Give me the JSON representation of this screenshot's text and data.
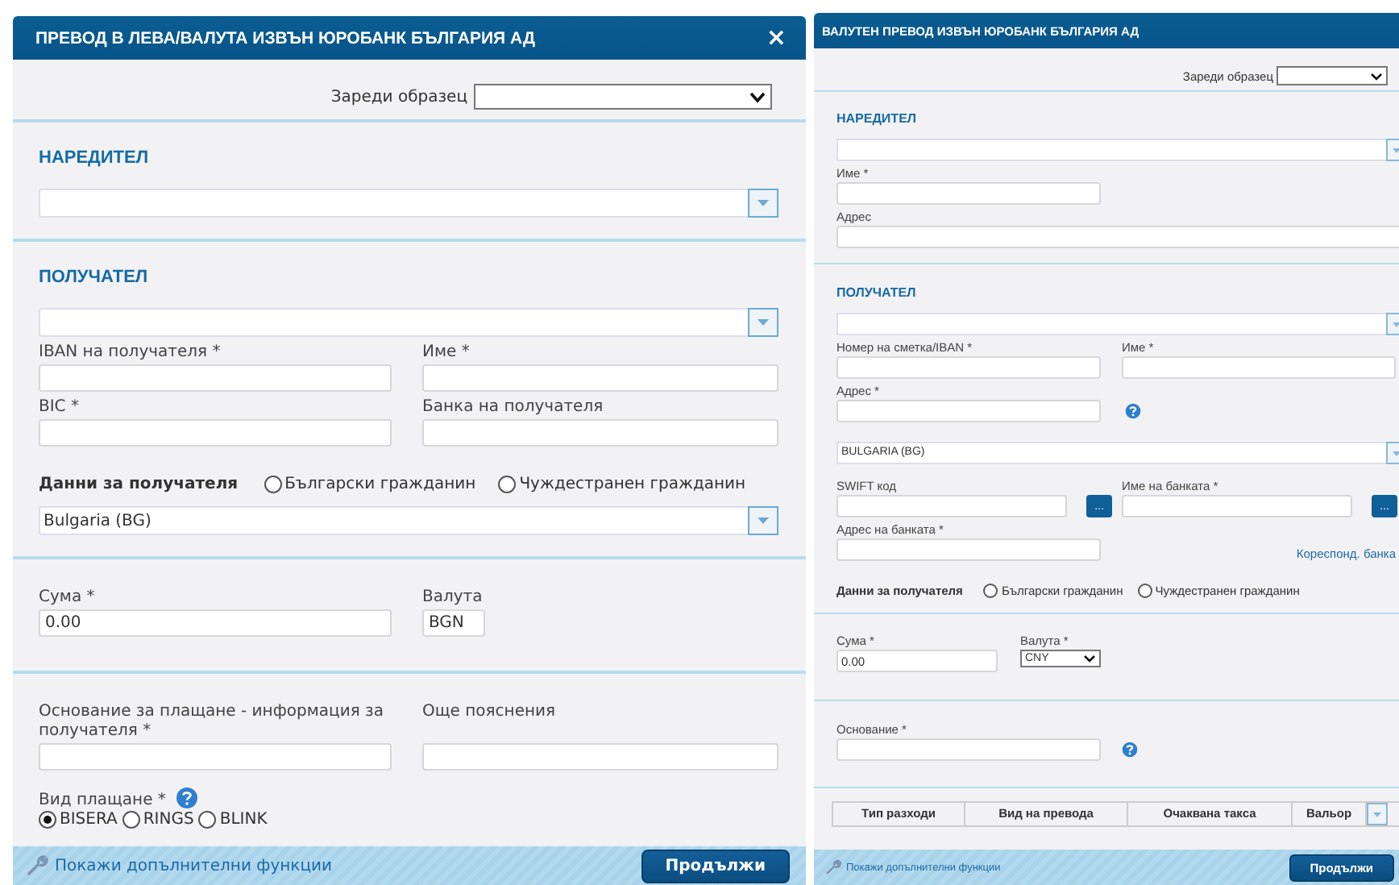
{
  "bgn_transfer": {
    "title": "ПРЕВОД В ЛЕВА/ВАЛУТА ИЗВЪН ЮРОБАНК БЪЛГАРИЯ АД",
    "close": "×",
    "template_label": "Зареди образец",
    "sender": {
      "heading": "НАРЕДИТЕЛ"
    },
    "recipient": {
      "heading": "ПОЛУЧАТЕЛ",
      "fields": [
        {
          "label": "IBAN на получателя *"
        },
        {
          "label": "Име *"
        },
        {
          "label": "BIC *"
        },
        {
          "label": "Банка на получателя"
        }
      ],
      "data_label": "Данни за получателя",
      "citizenship": [
        {
          "label": "Български гражданин",
          "selected": false
        },
        {
          "label": "Чуждестранен гражданин",
          "selected": false
        }
      ],
      "country": "Bulgaria (BG)"
    },
    "amount": {
      "label": "Сума *",
      "value": "0.00",
      "currency_label": "Валута",
      "currency": "BGN"
    },
    "reason": {
      "fields": [
        {
          "label": "Основание за плащане - информация за получателя *"
        },
        {
          "label": "Още пояснения"
        }
      ],
      "payment_type_label": "Вид плащане *",
      "payment_types": [
        {
          "label": "BISERA",
          "selected": true
        },
        {
          "label": "RINGS",
          "selected": false
        },
        {
          "label": "BLINK",
          "selected": false
        }
      ]
    },
    "footer": {
      "link": "Покажи допълнителни функции",
      "button": "Продължи"
    }
  },
  "currency_transfer": {
    "title": "ВАЛУТЕН ПРЕВОД ИЗВЪН ЮРОБАНК БЪЛГАРИЯ АД",
    "template_label": "Зареди образец",
    "sender": {
      "heading": "НАРЕДИТЕЛ",
      "name_label": "Име *",
      "address_label": "Адрес"
    },
    "recipient": {
      "heading": "ПОЛУЧАТЕЛ",
      "account_label": "Номер на сметка/IBAN *",
      "name_label": "Име *",
      "address_label": "Адрес *",
      "country": "BULGARIA (BG)",
      "swift_label": "SWIFT код",
      "bank_name_label": "Име на банката *",
      "lookup": "...",
      "bank_address_label": "Адрес на банката *",
      "correspondent_link": "Кореспонд. банка",
      "data_label": "Данни за получателя",
      "citizenship": [
        {
          "label": "Български гражданин",
          "selected": false
        },
        {
          "label": "Чуждестранен гражданин",
          "selected": false
        }
      ]
    },
    "amount": {
      "label": "Сума *",
      "value": "0.00",
      "currency_label": "Валута *",
      "currency": "CNY"
    },
    "reason": {
      "label": "Основание *"
    },
    "table": {
      "columns": [
        "Тип разходи",
        "Вид на превода",
        "Очаквана такса",
        "Вальор"
      ]
    },
    "footer": {
      "link": "Покажи допълнителни функции",
      "button": "Продължи"
    }
  }
}
